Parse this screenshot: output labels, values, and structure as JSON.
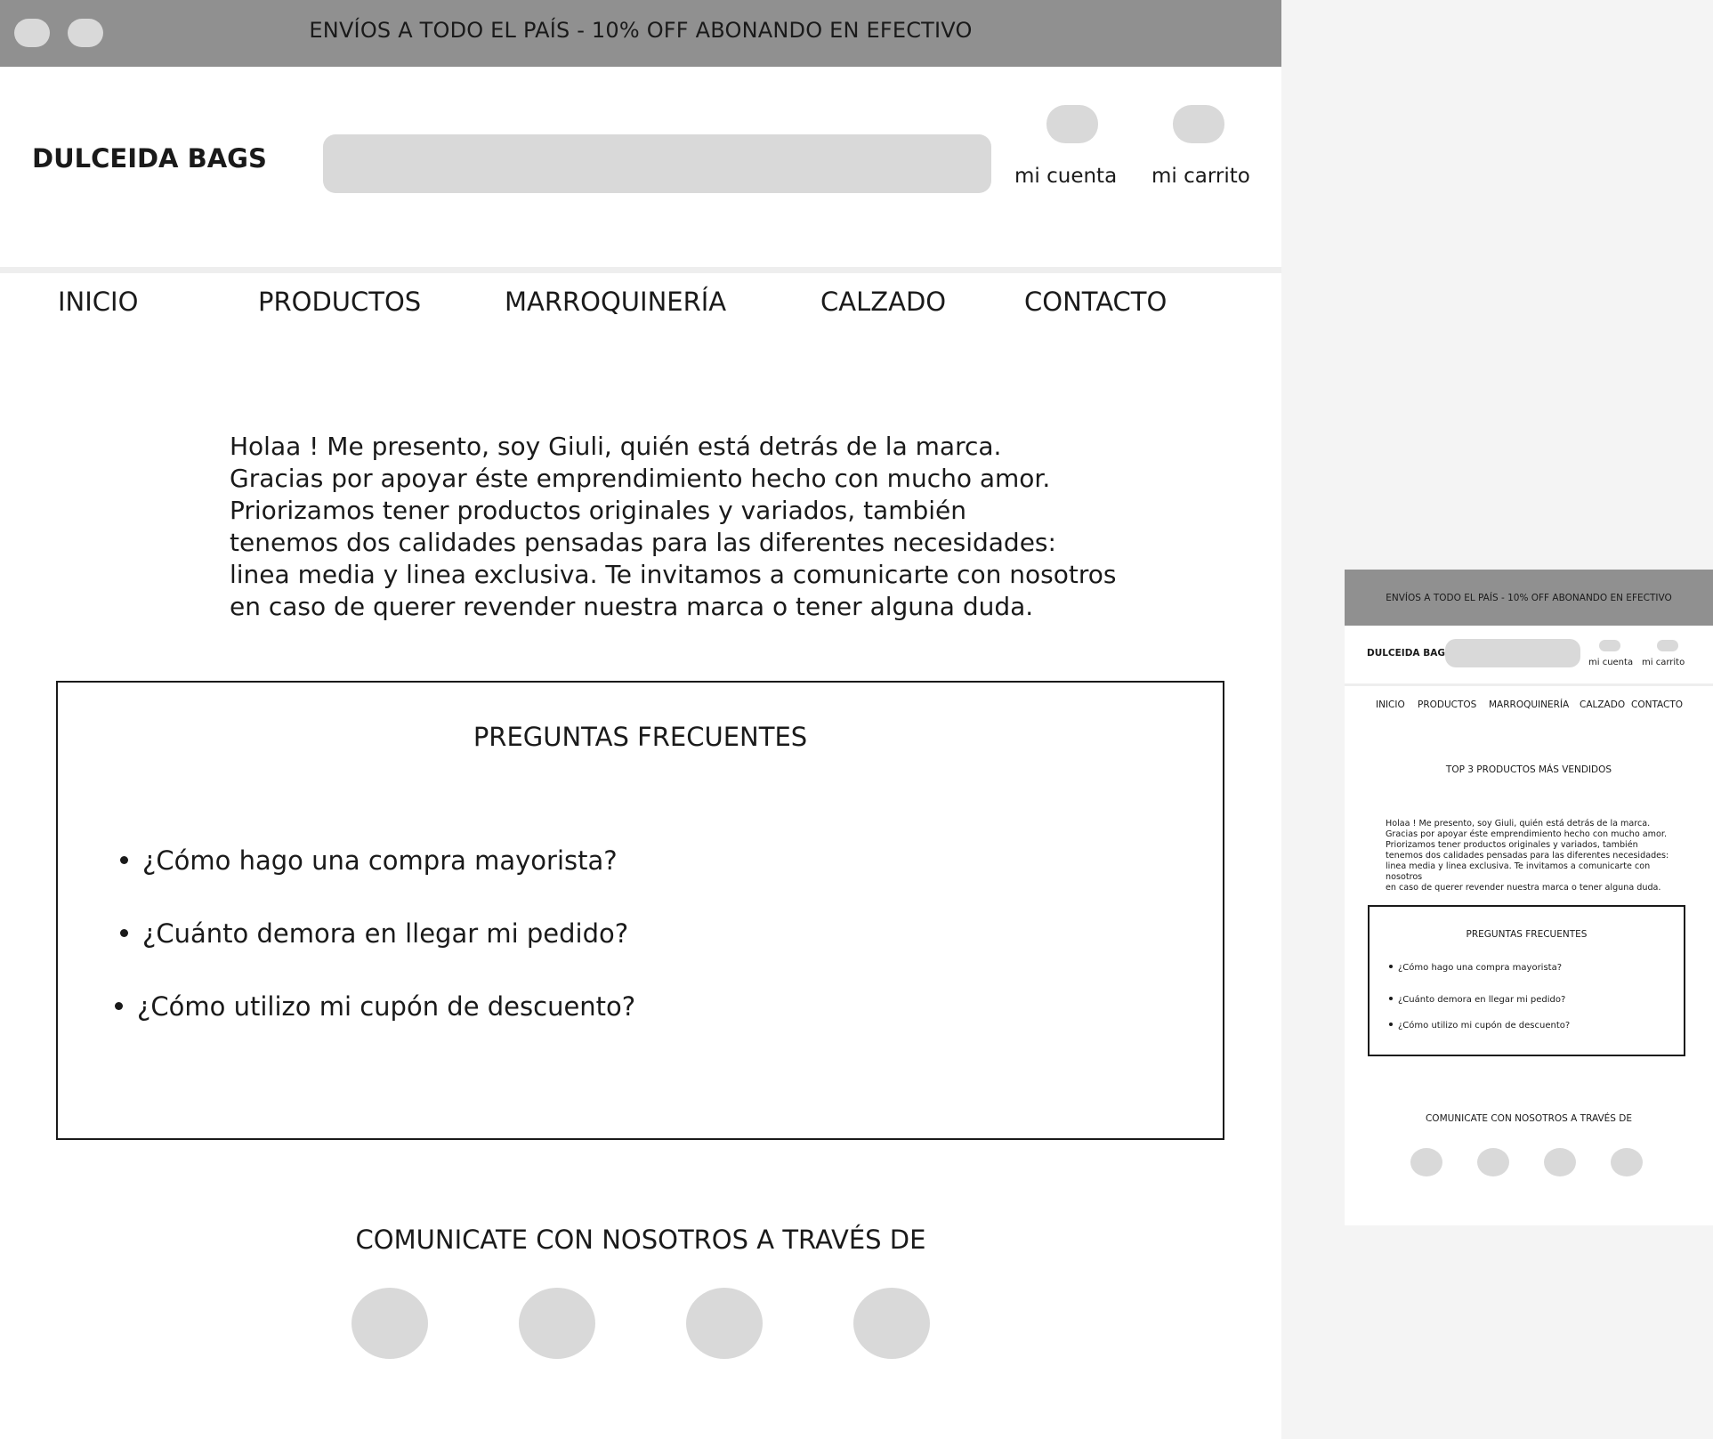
{
  "desktop": {
    "promo": "ENVÍOS A TODO EL PAÍS - 10% OFF ABONANDO EN EFECTIVO",
    "brand": "DULCEIDA BAGS",
    "search_value": "",
    "account_label": "mi cuenta",
    "cart_label": "mi carrito",
    "nav": [
      "INICIO",
      "PRODUCTOS",
      "MARROQUINERÍA",
      "CALZADO",
      "CONTACTO"
    ],
    "intro_lines": [
      "Holaa ! Me presento, soy Giuli, quién está detrás de la marca.",
      "Gracias por apoyar éste emprendimiento hecho con mucho amor.",
      "Priorizamos tener productos originales y variados, también",
      "tenemos dos calidades pensadas para las diferentes necesidades:",
      "linea media y linea exclusiva. Te invitamos a comunicarte con nosotros",
      "en caso de querer revender nuestra marca o tener alguna duda."
    ],
    "faq_title": "PREGUNTAS FRECUENTES",
    "faq_questions": [
      "¿Cómo hago una compra mayorista?",
      "¿Cuánto demora en llegar mi pedido?",
      "¿Cómo utilizo mi cupón de descuento?"
    ],
    "contact_title": "COMUNICATE CON NOSOTROS A TRAVÉS DE"
  },
  "mobile": {
    "promo": "ENVÍOS A TODO EL PAÍS - 10% OFF ABONANDO EN EFECTIVO",
    "brand": "DULCEIDA BAGS",
    "search_value": "",
    "account_label": "mi cuenta",
    "cart_label": "mi carrito",
    "nav": [
      "INICIO",
      "PRODUCTOS",
      "MARROQUINERÍA",
      "CALZADO",
      "CONTACTO"
    ],
    "top3_title": "TOP 3 PRODUCTOS MÁS VENDIDOS",
    "intro_lines": [
      "Holaa ! Me presento, soy Giuli, quién está detrás de la marca.",
      "Gracias por apoyar éste emprendimiento hecho con mucho amor.",
      "Priorizamos tener productos originales y variados, también",
      "tenemos dos calidades pensadas para las diferentes necesidades:",
      "linea media y linea exclusiva. Te invitamos a comunicarte con nosotros",
      "en caso de querer revender nuestra marca o tener alguna duda."
    ],
    "faq_title": "PREGUNTAS FRECUENTES",
    "faq_questions": [
      "¿Cómo hago una compra mayorista?",
      "¿Cuánto demora en llegar mi pedido?",
      "¿Cómo utilizo mi cupón de descuento?"
    ],
    "contact_title": "COMUNICATE CON NOSOTROS A TRAVÉS DE"
  },
  "colors": {
    "topbar": "#909090",
    "placeholder": "#d9d9d9",
    "page": "#ffffff",
    "background": "#f4f4f4",
    "text": "#1a1a1a"
  },
  "icons": {
    "window_controls": [
      "window-control-icon",
      "window-control-icon"
    ],
    "account": "account-icon",
    "cart": "cart-icon",
    "social": [
      "social-icon",
      "social-icon",
      "social-icon",
      "social-icon"
    ]
  }
}
